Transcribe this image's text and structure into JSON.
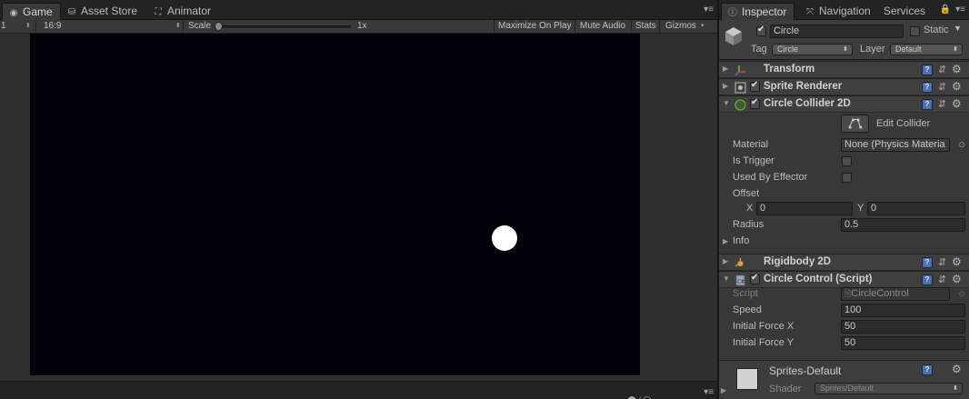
{
  "game_panel": {
    "tabs": [
      {
        "label": "Game",
        "icon": "game-controller-icon",
        "active": true
      },
      {
        "label": "Asset Store",
        "icon": "shopping-bag-icon",
        "active": false
      },
      {
        "label": "Animator",
        "icon": "animator-icon",
        "active": false
      }
    ],
    "toolbar": {
      "display": "1",
      "aspect": "16:9",
      "scale_label": "Scale",
      "scale_value": "1x",
      "maximize_on_play": "Maximize On Play",
      "mute_audio": "Mute Audio",
      "stats": "Stats",
      "gizmos": "Gizmos"
    },
    "canvas_color": "#03020b",
    "ball_color": "#ffffff"
  },
  "inspector": {
    "tabs": [
      {
        "label": "Inspector",
        "icon": "info-icon",
        "active": true
      },
      {
        "label": "Navigation",
        "icon": "navigation-icon",
        "active": false
      },
      {
        "label": "Services",
        "active": false
      }
    ],
    "gameobject": {
      "active": true,
      "name": "Circle",
      "static_label": "Static",
      "tag_label": "Tag",
      "tag_value": "Circle",
      "layer_label": "Layer",
      "layer_value": "Default"
    },
    "components": {
      "transform": {
        "name": "Transform"
      },
      "sprite_renderer": {
        "name": "Sprite Renderer",
        "enabled": true
      },
      "circle_collider": {
        "name": "Circle Collider 2D",
        "enabled": true,
        "edit_collider_label": "Edit Collider",
        "material_label": "Material",
        "material_value": "None (Physics Materia",
        "is_trigger_label": "Is Trigger",
        "is_trigger": false,
        "used_by_effector_label": "Used By Effector",
        "used_by_effector": false,
        "offset_label": "Offset",
        "offset_x_label": "X",
        "offset_x": "0",
        "offset_y_label": "Y",
        "offset_y": "0",
        "radius_label": "Radius",
        "radius": "0.5",
        "info_label": "Info"
      },
      "rigidbody": {
        "name": "Rigidbody 2D"
      },
      "circle_control": {
        "name": "Circle Control (Script)",
        "enabled": true,
        "script_label": "Script",
        "script_value": "CircleControl",
        "speed_label": "Speed",
        "speed": "100",
        "initial_force_x_label": "Initial Force X",
        "initial_force_x": "50",
        "initial_force_y_label": "Initial Force Y",
        "initial_force_y": "50"
      }
    },
    "material": {
      "name": "Sprites-Default",
      "shader_label": "Shader",
      "shader_value": "Sprites/Default"
    }
  }
}
